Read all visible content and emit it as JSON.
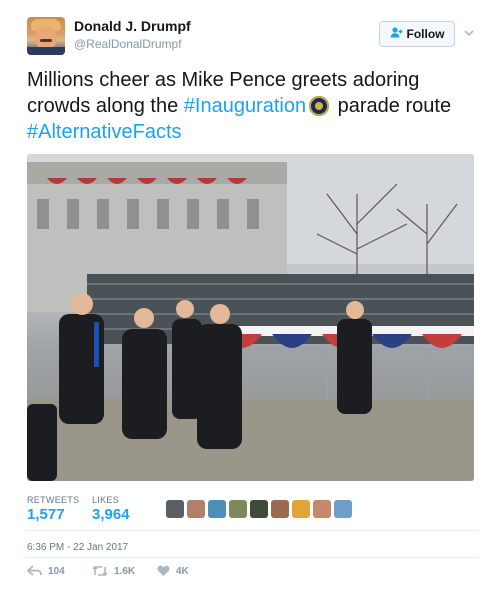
{
  "author": {
    "display_name": "Donald J. Drumpf",
    "handle": "@RealDonalDrumpf"
  },
  "follow_button": {
    "label": "Follow",
    "icon": "add-person-icon"
  },
  "tweet": {
    "text_part1": "Millions cheer as Mike Pence greets adoring crowds along the ",
    "hashtag1": "#Inauguration",
    "emoji": "presidential-seal-emoji",
    "text_part2": " parade route ",
    "hashtag2": "#AlternativeFacts"
  },
  "stats": {
    "retweets_label": "RETWEETS",
    "retweets_value": "1,577",
    "likes_label": "LIKES",
    "likes_value": "3,964"
  },
  "likers_count": 9,
  "timestamp": "6:36 PM - 22 Jan 2017",
  "actions": {
    "reply_count": "104",
    "retweet_count": "1.6K",
    "like_count": "4K"
  },
  "colors": {
    "accent": "#1da1f2",
    "text": "#14171a",
    "muted": "#657786"
  }
}
